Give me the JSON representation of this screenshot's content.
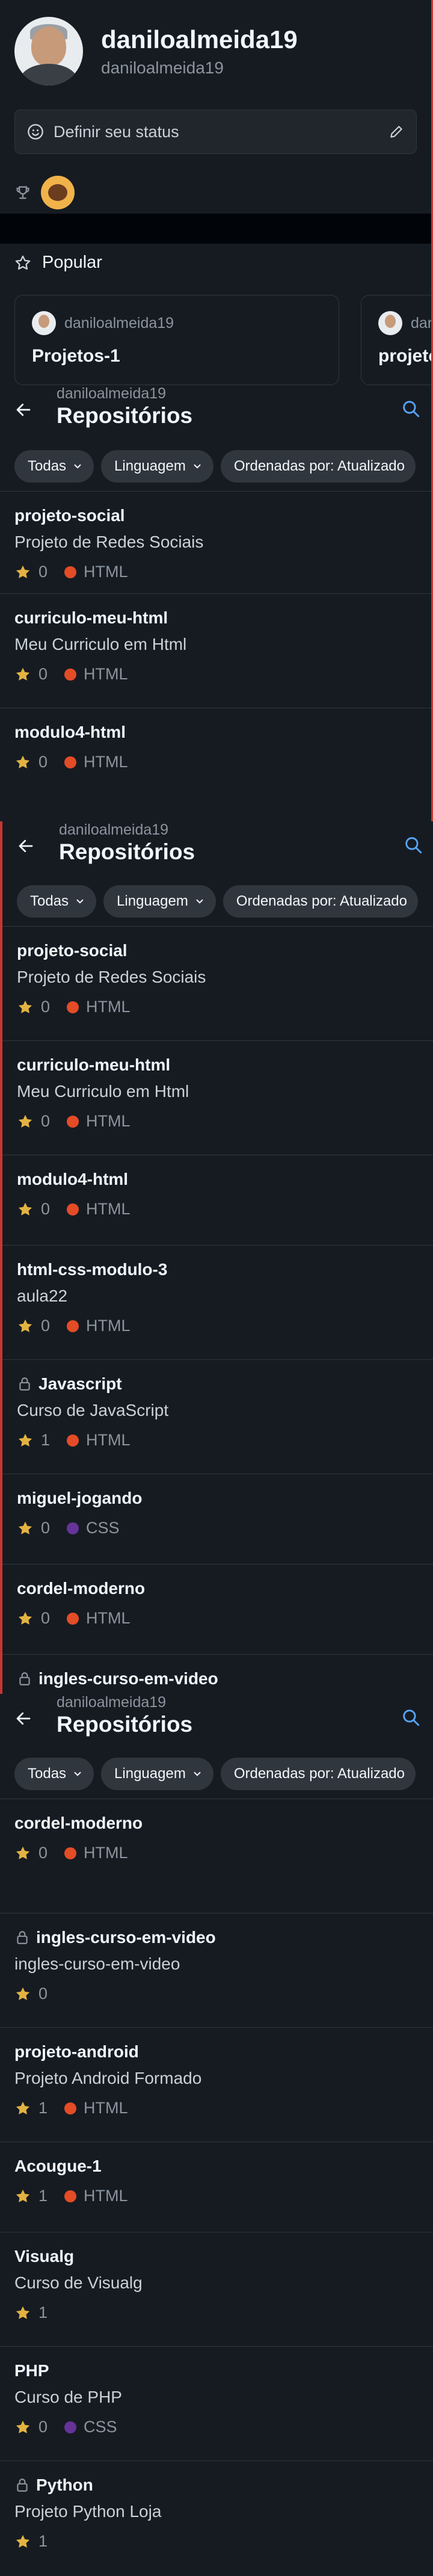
{
  "profile": {
    "name": "daniloalmeida19",
    "login": "daniloalmeida19",
    "status_placeholder": "Definir seu status"
  },
  "popular": {
    "title": "Popular",
    "cards": [
      {
        "owner": "daniloalmeida19",
        "repo": "Projetos-1"
      },
      {
        "owner": "dan",
        "repo": "projeto"
      }
    ]
  },
  "repos_header": {
    "owner": "daniloalmeida19",
    "title": "Repositórios",
    "filters": [
      "Todas",
      "Linguagem",
      "Ordenadas por: Atualizado"
    ]
  },
  "colors": {
    "HTML": "#e34c26",
    "CSS": "#663399",
    "star": "#e3b341",
    "accent": "#c9362f"
  },
  "list1": [
    {
      "name": "projeto-social",
      "desc": "Projeto de Redes Sociais",
      "stars": "0",
      "lang": "HTML",
      "locked": false
    },
    {
      "name": "curriculo-meu-html",
      "desc": "Meu Curriculo em Html",
      "stars": "0",
      "lang": "HTML",
      "locked": false
    },
    {
      "name": "modulo4-html",
      "desc": "",
      "stars": "0",
      "lang": "HTML",
      "locked": false
    }
  ],
  "list2": [
    {
      "name": "projeto-social",
      "desc": "Projeto de Redes Sociais",
      "stars": "0",
      "lang": "HTML",
      "locked": false
    },
    {
      "name": "curriculo-meu-html",
      "desc": "Meu Curriculo em Html",
      "stars": "0",
      "lang": "HTML",
      "locked": false
    },
    {
      "name": "modulo4-html",
      "desc": "",
      "stars": "0",
      "lang": "HTML",
      "locked": false
    },
    {
      "name": "html-css-modulo-3",
      "desc": "aula22",
      "stars": "0",
      "lang": "HTML",
      "locked": false
    },
    {
      "name": "Javascript",
      "desc": "Curso de JavaScript",
      "stars": "1",
      "lang": "HTML",
      "locked": true
    },
    {
      "name": "miguel-jogando",
      "desc": "",
      "stars": "0",
      "lang": "CSS",
      "locked": false
    },
    {
      "name": "cordel-moderno",
      "desc": "",
      "stars": "0",
      "lang": "HTML",
      "locked": false
    },
    {
      "name": "ingles-curso-em-video",
      "desc": "",
      "stars": "",
      "lang": "",
      "locked": true
    }
  ],
  "list3": [
    {
      "name": "cordel-moderno",
      "desc": "",
      "stars": "0",
      "lang": "HTML",
      "locked": false
    },
    {
      "name": "ingles-curso-em-video",
      "desc": "ingles-curso-em-video",
      "stars": "0",
      "lang": "",
      "locked": true
    },
    {
      "name": "projeto-android",
      "desc": "Projeto Android Formado",
      "stars": "1",
      "lang": "HTML",
      "locked": false
    },
    {
      "name": "Acougue-1",
      "desc": "",
      "stars": "1",
      "lang": "HTML",
      "locked": false
    },
    {
      "name": "Visualg",
      "desc": "Curso de Visualg",
      "stars": "1",
      "lang": "",
      "locked": false
    },
    {
      "name": "PHP",
      "desc": "Curso de PHP",
      "stars": "0",
      "lang": "CSS",
      "locked": false
    },
    {
      "name": "Python",
      "desc": "Projeto Python Loja",
      "stars": "1",
      "lang": "",
      "locked": true
    }
  ]
}
